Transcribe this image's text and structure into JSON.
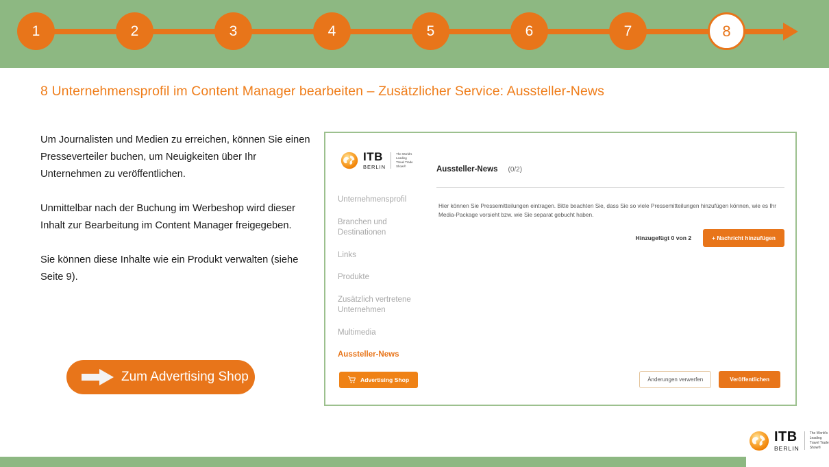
{
  "colors": {
    "green": "#8db882",
    "orange": "#e8751a",
    "title_orange": "#ef7d1a",
    "panel_border": "#9cc08e",
    "nav_grey": "#a8a8a8"
  },
  "stepbar": {
    "steps": [
      {
        "label": "1",
        "current": false
      },
      {
        "label": "2",
        "current": false
      },
      {
        "label": "3",
        "current": false
      },
      {
        "label": "4",
        "current": false
      },
      {
        "label": "5",
        "current": false
      },
      {
        "label": "6",
        "current": false
      },
      {
        "label": "7",
        "current": false
      },
      {
        "label": "8",
        "current": true
      }
    ]
  },
  "slide": {
    "title": "8 Unternehmensprofil im Content Manager bearbeiten – Zusätzlicher Service: Aussteller-News",
    "paragraphs": [
      "Um Journalisten und Medien zu erreichen, können Sie einen Presseverteiler buchen, um Neuigkeiten über Ihr Unternehmen zu veröffentlichen.",
      "Unmittelbar nach der Buchung im Werbeshop wird dieser Inhalt zur Bearbeitung im Content Manager freigegeben.",
      "Sie können diese Inhalte wie ein Produkt verwalten (siehe Seite 9)."
    ],
    "cta_label": "Zum Advertising Shop"
  },
  "brand": {
    "name": "ITB",
    "city": "BERLIN",
    "tagline": "The World's Leading Travel Trade Show®",
    "tagline_lines": [
      "The World's",
      "Leading",
      "Travel Trade",
      "Show®"
    ]
  },
  "panel": {
    "header": {
      "title": "Aussteller-News",
      "count": "(0/2)"
    },
    "nav": [
      {
        "label": "Unternehmensprofil",
        "active": false
      },
      {
        "label": "Branchen und Destinationen",
        "active": false
      },
      {
        "label": "Links",
        "active": false
      },
      {
        "label": "Produkte",
        "active": false
      },
      {
        "label": "Zusätzlich vertretene Unternehmen",
        "active": false
      },
      {
        "label": "Multimedia",
        "active": false
      },
      {
        "label": "Aussteller-News",
        "active": true
      }
    ],
    "description": "Hier können Sie Pressemitteilungen eintragen. Bitte beachten Sie, dass Sie so viele Pressemitteilungen hinzufügen können, wie es Ihr Media-Package vorsieht bzw. wie Sie separat gebucht haben.",
    "added_count": "Hinzugefügt 0 von 2",
    "add_button": "+ Nachricht hinzufügen",
    "shop_button": "Advertising Shop",
    "discard_button": "Änderungen verwerfen",
    "publish_button": "Veröffentlichen"
  }
}
